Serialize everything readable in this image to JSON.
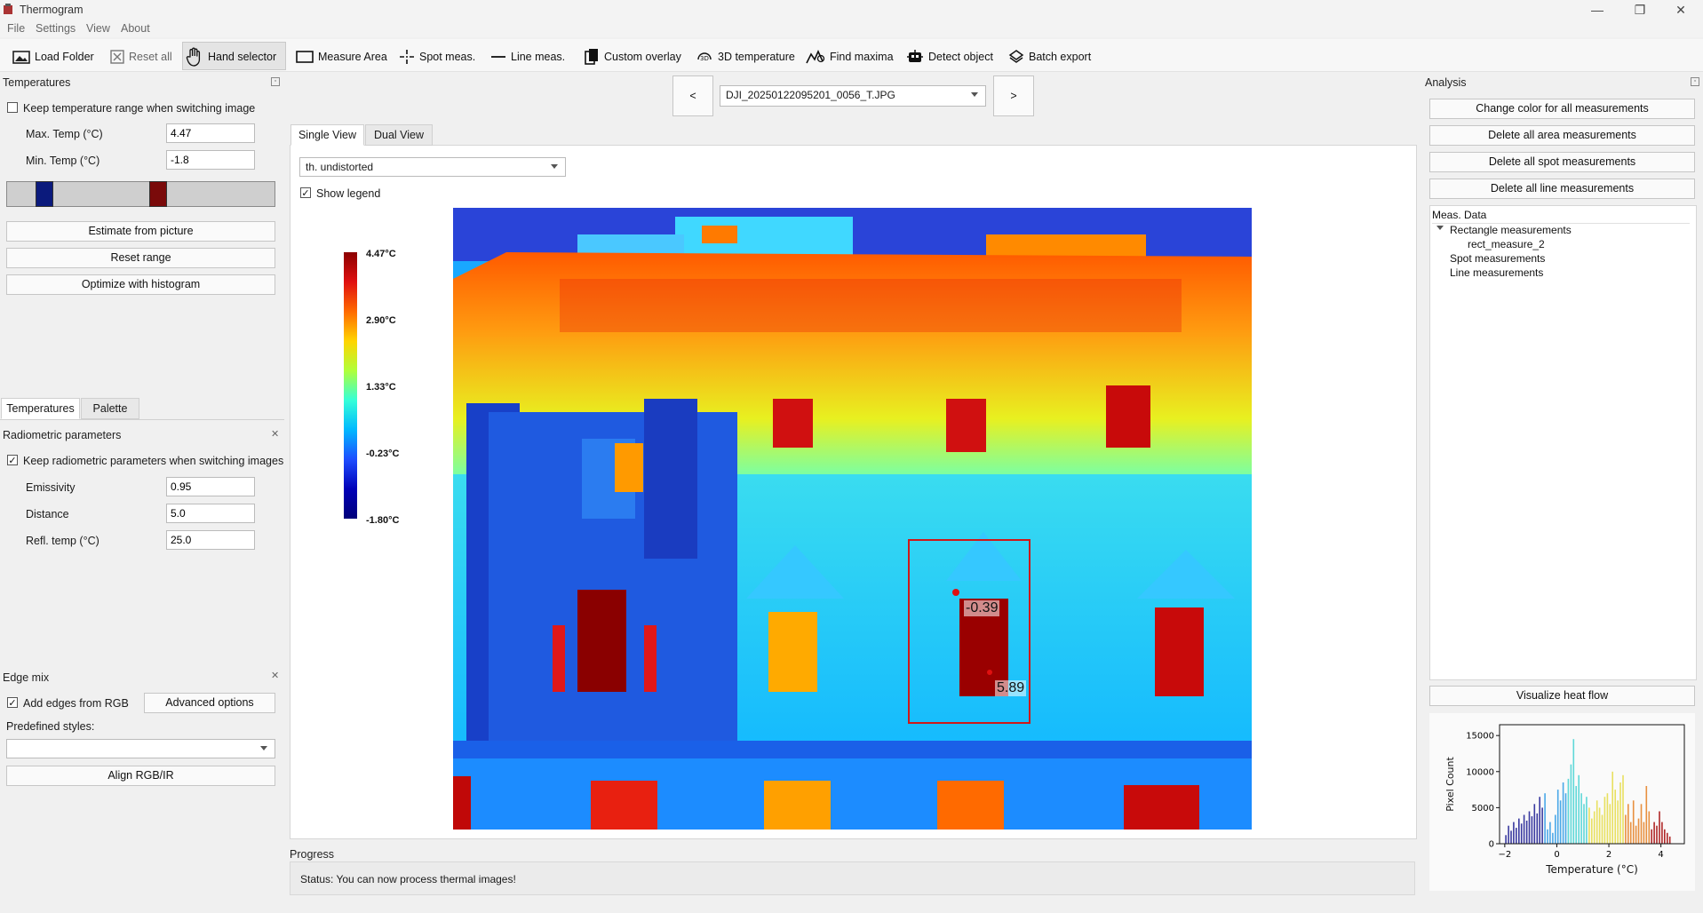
{
  "window": {
    "title": "Thermogram",
    "minimize": "—",
    "maximize": "❐",
    "close": "✕"
  },
  "menu": [
    "File",
    "Settings",
    "View",
    "About"
  ],
  "toolbar": {
    "load_folder": "Load Folder",
    "reset_all": "Reset all",
    "hand_selector": "Hand selector",
    "measure_area": "Measure Area",
    "spot_meas": "Spot meas.",
    "line_meas": "Line meas.",
    "custom_overlay": "Custom overlay",
    "temp_3d": "3D temperature",
    "find_maxima": "Find maxima",
    "detect_object": "Detect object",
    "batch_export": "Batch export"
  },
  "temperatures_panel": {
    "title": "Temperatures",
    "keep_range_label": "Keep temperature range when switching image",
    "keep_range_checked": false,
    "max_temp_label": "Max. Temp (°C)",
    "max_temp_value": "4.47",
    "min_temp_label": "Min. Temp (°C)",
    "min_temp_value": "-1.8",
    "estimate_button": "Estimate from picture",
    "reset_range_button": "Reset range",
    "optimize_button": "Optimize with histogram",
    "tabs": [
      "Temperatures",
      "Palette"
    ],
    "active_tab": "Temperatures"
  },
  "radiometric_panel": {
    "title": "Radiometric parameters",
    "keep_params_label": "Keep radiometric parameters when switching images",
    "keep_params_checked": true,
    "emissivity_label": "Emissivity",
    "emissivity_value": "0.95",
    "distance_label": "Distance",
    "distance_value": "5.0",
    "refl_temp_label": "Refl. temp (°C)",
    "refl_temp_value": "25.0"
  },
  "edge_panel": {
    "title": "Edge mix",
    "add_edges_label": "Add edges from RGB",
    "add_edges_checked": true,
    "advanced_button": "Advanced  options",
    "predefined_label": "Predefined styles:",
    "predefined_value": "",
    "align_button": "Align RGB/IR"
  },
  "navigation": {
    "prev": "<",
    "next": ">",
    "image_name": "DJI_20250122095201_0056_T.JPG"
  },
  "view_tabs": [
    "Single View",
    "Dual View"
  ],
  "active_view_tab": "Single View",
  "display_mode": "th. undistorted",
  "show_legend_label": "Show legend",
  "show_legend_checked": true,
  "legend": {
    "ticks": [
      "4.47°C",
      "2.90°C",
      "1.33°C",
      "-0.23°C",
      "-1.80°C"
    ],
    "colors": [
      "#8b0000",
      "#e01010",
      "#ff6a00",
      "#ffd400",
      "#35ffd8",
      "#00b8ff",
      "#1e4dff",
      "#00007a"
    ]
  },
  "measurement": {
    "min_label": "-0.39",
    "max_label": "5.89",
    "color": "#d01818"
  },
  "progress": {
    "title": "Progress",
    "status": "Status: You can now process thermal images!"
  },
  "analysis_panel": {
    "title": "Analysis",
    "change_color_button": "Change color for all measurements",
    "delete_area_button": "Delete all area measurements",
    "delete_spot_button": "Delete all spot measurements",
    "delete_line_button": "Delete all line measurements",
    "tree_header": "Meas. Data",
    "tree": {
      "rect_group": "Rectangle measurements",
      "rect_child": "rect_measure_2",
      "spot_group": "Spot measurements",
      "line_group": "Line measurements"
    },
    "heat_flow_button": "Visualize heat flow"
  },
  "chart_data": {
    "type": "bar",
    "title": "",
    "xlabel": "Temperature (°C)",
    "ylabel": "Pixel Count",
    "xlim": [
      -2.2,
      4.9
    ],
    "ylim": [
      0,
      16500
    ],
    "x_ticks": [
      "−2",
      "0",
      "2",
      "4"
    ],
    "y_ticks": [
      "0",
      "5000",
      "10000",
      "15000"
    ],
    "x": [
      -1.95,
      -1.85,
      -1.75,
      -1.65,
      -1.55,
      -1.45,
      -1.35,
      -1.25,
      -1.15,
      -1.05,
      -0.95,
      -0.85,
      -0.75,
      -0.65,
      -0.55,
      -0.45,
      -0.35,
      -0.25,
      -0.15,
      -0.05,
      0.05,
      0.15,
      0.25,
      0.35,
      0.45,
      0.55,
      0.65,
      0.75,
      0.85,
      0.95,
      1.05,
      1.15,
      1.25,
      1.35,
      1.45,
      1.55,
      1.65,
      1.75,
      1.85,
      1.95,
      2.05,
      2.15,
      2.25,
      2.35,
      2.45,
      2.55,
      2.65,
      2.75,
      2.85,
      2.95,
      3.05,
      3.15,
      3.25,
      3.35,
      3.45,
      3.55,
      3.65,
      3.75,
      3.85,
      3.95,
      4.05,
      4.15,
      4.25,
      4.35
    ],
    "values": [
      1200,
      2500,
      1800,
      3000,
      2200,
      3500,
      2800,
      4000,
      3200,
      4500,
      3800,
      5500,
      4200,
      6500,
      5000,
      7000,
      2000,
      3000,
      1500,
      4000,
      7500,
      6000,
      8500,
      7000,
      9000,
      11000,
      14500,
      8000,
      9500,
      7000,
      5500,
      6500,
      5000,
      3500,
      4500,
      6000,
      5000,
      4000,
      6500,
      7000,
      5500,
      10000,
      7500,
      6000,
      8500,
      9500,
      4000,
      5500,
      3000,
      6000,
      2500,
      3500,
      5500,
      3000,
      8000,
      4500,
      2000,
      3000,
      2500,
      4500,
      3000,
      2000,
      1500,
      1000
    ]
  }
}
